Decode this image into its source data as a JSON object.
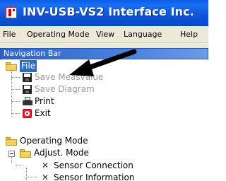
{
  "window": {
    "title": "INV-USB-VS2 Interface Inc."
  },
  "menubar": {
    "items": [
      "File",
      "Operating Mode",
      "View",
      "Language",
      "Help"
    ]
  },
  "panel": {
    "header": "Navigation Bar"
  },
  "tree": {
    "file": "File",
    "save_measvalue": "Save Measvalue",
    "save_diagram": "Save Diagram",
    "print": "Print",
    "exit": "Exit",
    "operating_mode": "Operating Mode",
    "adjust_mode": "Adjust. Mode",
    "sensor_connection": "Sensor Connection",
    "sensor_information": "Sensor Information"
  },
  "colors": {
    "title_bar": "#0a5fe8",
    "selection": "#316ac5",
    "annotation_arrow": "#000000"
  }
}
